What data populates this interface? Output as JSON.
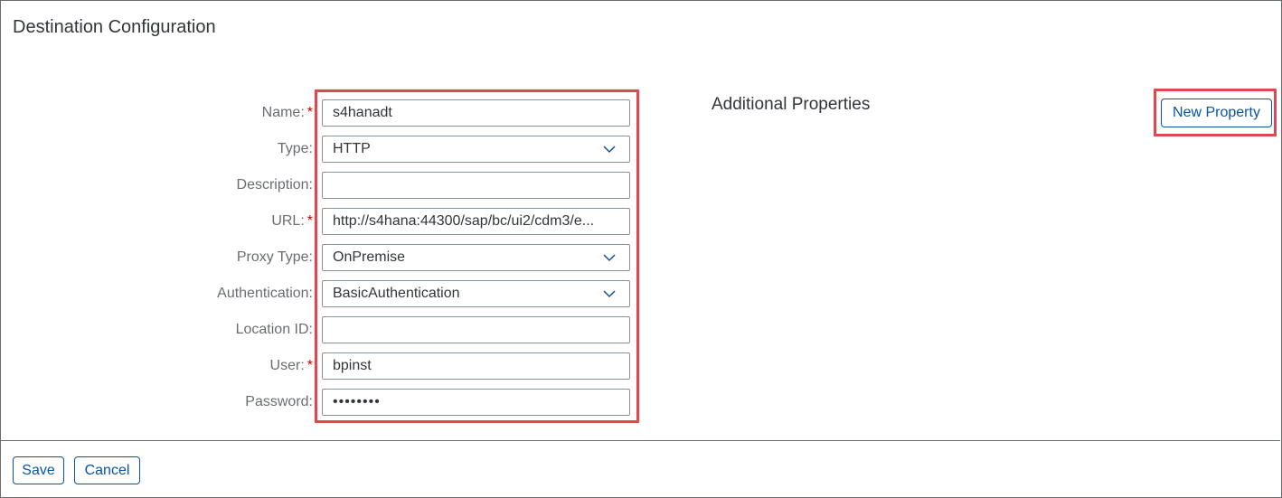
{
  "dialog": {
    "title": "Destination Configuration"
  },
  "form": {
    "fields": [
      {
        "label": "Name:",
        "required": true,
        "value": "s4hanadt",
        "kind": "input"
      },
      {
        "label": "Type:",
        "required": false,
        "value": "HTTP",
        "kind": "select"
      },
      {
        "label": "Description:",
        "required": false,
        "value": "",
        "kind": "input"
      },
      {
        "label": "URL:",
        "required": true,
        "value": "http://s4hana:44300/sap/bc/ui2/cdm3/e...",
        "kind": "input"
      },
      {
        "label": "Proxy Type:",
        "required": false,
        "value": "OnPremise",
        "kind": "select"
      },
      {
        "label": "Authentication:",
        "required": false,
        "value": "BasicAuthentication",
        "kind": "select"
      },
      {
        "label": "Location ID:",
        "required": false,
        "value": "",
        "kind": "input"
      },
      {
        "label": "User:",
        "required": true,
        "value": "bpinst",
        "kind": "input"
      },
      {
        "label": "Password:",
        "required": false,
        "value": "••••••••",
        "kind": "password"
      }
    ],
    "required_marker": "*"
  },
  "additional_properties": {
    "heading": "Additional Properties",
    "new_property_label": "New Property"
  },
  "footer": {
    "save_label": "Save",
    "cancel_label": "Cancel"
  },
  "colors": {
    "accent": "#0854a0",
    "required": "#bb0000",
    "highlight": "#e0484f"
  },
  "icons": {
    "select_chevron": "chevron-down-icon"
  }
}
